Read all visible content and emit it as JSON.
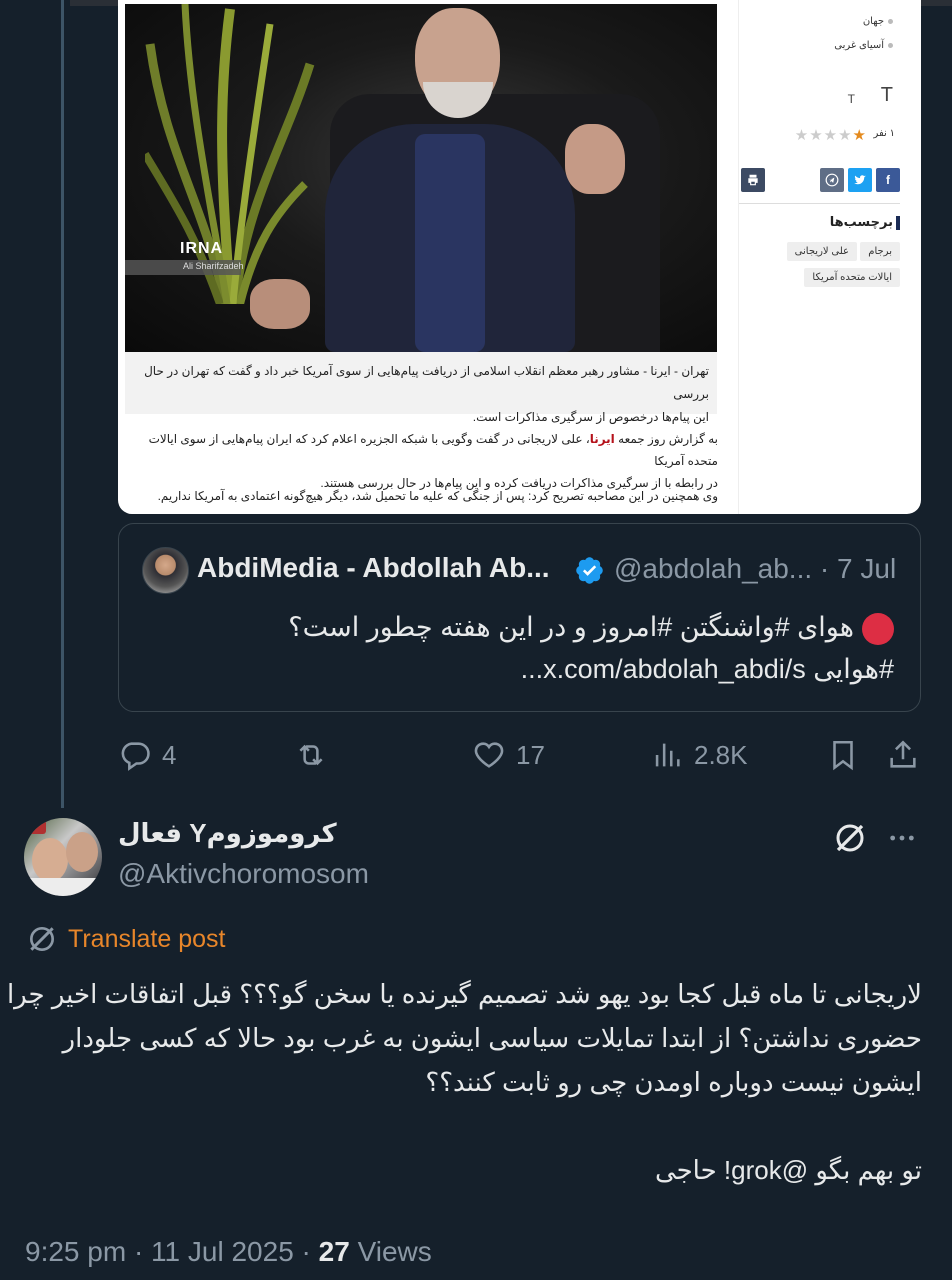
{
  "article": {
    "breadcrumb": [
      "جهان",
      "آسیای غربی"
    ],
    "font_size_small": "T",
    "font_size_large": "T",
    "rating_count": "۱ نفر",
    "rating_stars": 1,
    "rating_max": 5,
    "share_buttons": [
      "facebook-icon",
      "twitter-icon",
      "telegram-icon",
      "print-icon"
    ],
    "tags_title": "برچسب‌ها",
    "tags": [
      "برجام",
      "علی لاریجانی",
      "ایالات متحده آمریکا"
    ],
    "image_watermark": "IRNA",
    "image_credit": "Ali Sharifzadeh",
    "caption_line1": "تهران - ایرنا - مشاور رهبر معظم انقلاب اسلامی از دریافت پیام‌هایی از سوی آمریکا خبر داد و گفت که تهران در حال بررسی",
    "caption_line2": "این پیام‌ها درخصوص از سرگیری مذاکرات است.",
    "body_line1_before": "به گزارش روز جمعه ",
    "body_line1_source": "ایرنا",
    "body_line1_after": "، علی لاریجانی در گفت وگویی با شبکه الجزیره اعلام کرد که ایران پیام‌هایی از سوی ایالات متحده آمریکا",
    "body_line2": "در رابطه با از سرگیری مذاکرات دریافت کرده و این پیام‌ها در حال بررسی هستند.",
    "body_line3": "وی همچنین در این مصاحبه تصریح کرد: پس از جنگی که علیه ما تحمیل شد، دیگر هیچ‌گونه اعتمادی به آمریکا نداریم."
  },
  "quote": {
    "name": "AbdiMedia - Abdollah Ab...",
    "handle_date": "@abdolah_ab... · 7 Jul",
    "text_line1": "هوای #واشنگتن #امروز و در این هفته چطور است؟",
    "text_line2": "#هوایی x.com/abdolah_abdi/s..."
  },
  "actions": {
    "replies": "4",
    "likes": "17",
    "views": "2.8K"
  },
  "tweet": {
    "name": "فعال Yکروموزوم",
    "handle": "@Aktivchoromosom",
    "translate_label": "Translate post",
    "lines": [
      "لاریجانی تا ماه قبل کجا بود یهو شد تصمیم گیرنده یا سخن گو؟؟؟ قبل اتفاقات اخیر چرا",
      "حضوری نداشتن؟ از ابتدا تمایلات سیاسی ایشون به غرب بود حالا که کسی جلودار",
      "ایشون نیست دوباره اومدن چی رو ثابت کنند؟؟",
      "تو بهم بگو @grok! حاجی"
    ],
    "time_date": "9:25 pm · 11 Jul 2025 · ",
    "views_count": "27",
    "views_label": " Views"
  },
  "colors": {
    "background": "#15202b",
    "secondary_text": "#8b98a5",
    "translate": "#e8862a",
    "verified": "#1d9bf0",
    "border": "#38444d"
  }
}
